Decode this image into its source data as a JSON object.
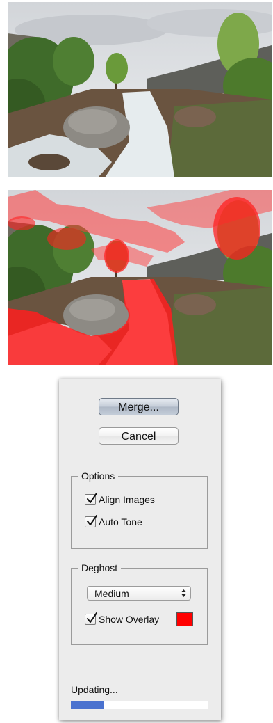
{
  "images": [
    {
      "name": "Waterfall photo",
      "overlay": false
    },
    {
      "name": "Waterfall photo with deghost overlay",
      "overlay": true
    }
  ],
  "dialog": {
    "merge_button": "Merge...",
    "cancel_button": "Cancel",
    "options": {
      "title": "Options",
      "align_images": {
        "label": "Align Images",
        "checked": true
      },
      "auto_tone": {
        "label": "Auto Tone",
        "checked": true
      }
    },
    "deghost": {
      "title": "Deghost",
      "level": "Medium",
      "show_overlay": {
        "label": "Show Overlay",
        "checked": true
      },
      "overlay_color": "#ff0000"
    },
    "status": "Updating...",
    "progress": 0.24
  },
  "colors": {
    "accent": "#4a72cf",
    "overlay": "#ff0000",
    "panel": "#ececec"
  }
}
